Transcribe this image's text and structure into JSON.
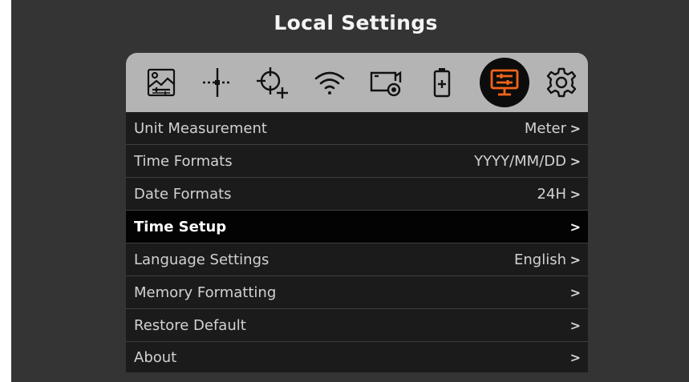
{
  "header": {
    "title": "Local Settings"
  },
  "tabs": [
    {
      "icon": "image-adjust-icon"
    },
    {
      "icon": "crosshair-icon"
    },
    {
      "icon": "reticle-add-icon"
    },
    {
      "icon": "wifi-icon"
    },
    {
      "icon": "camera-record-icon"
    },
    {
      "icon": "battery-icon"
    },
    {
      "icon": "display-settings-icon",
      "active": true
    },
    {
      "icon": "gear-icon"
    }
  ],
  "colors": {
    "accent": "#f26419",
    "active_tab_bg": "#0c0c0c",
    "tabbar_bg": "#b4b4b4"
  },
  "menu": {
    "items": [
      {
        "label": "Unit Measurement",
        "value": "Meter"
      },
      {
        "label": "Time Formats",
        "value": "YYYY/MM/DD"
      },
      {
        "label": "Date Formats",
        "value": "24H"
      },
      {
        "label": "Time Setup",
        "value": "",
        "selected": true
      },
      {
        "label": "Language Settings",
        "value": "English"
      },
      {
        "label": "Memory Formatting",
        "value": ""
      },
      {
        "label": "Restore Default",
        "value": ""
      },
      {
        "label": "About",
        "value": ""
      }
    ],
    "chevron": ">"
  }
}
